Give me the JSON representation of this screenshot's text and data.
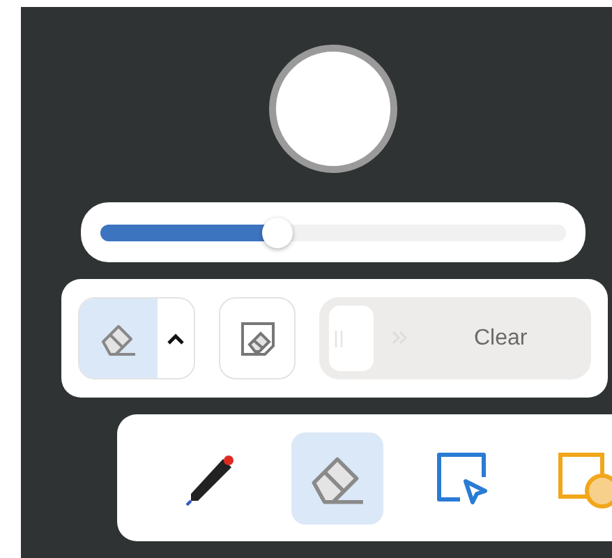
{
  "size_slider": {
    "level": 0.38
  },
  "eraser_options": {
    "buttons": [
      {
        "kind": "eraser",
        "selected": true
      },
      {
        "kind": "area-eraser",
        "selected": false
      }
    ],
    "clear_slider": {
      "label": "Clear",
      "level": 0
    }
  },
  "toolbar": {
    "tools": [
      {
        "kind": "pen",
        "selected": false
      },
      {
        "kind": "eraser",
        "selected": true
      },
      {
        "kind": "select",
        "selected": false
      },
      {
        "kind": "shape",
        "selected": false
      }
    ]
  }
}
